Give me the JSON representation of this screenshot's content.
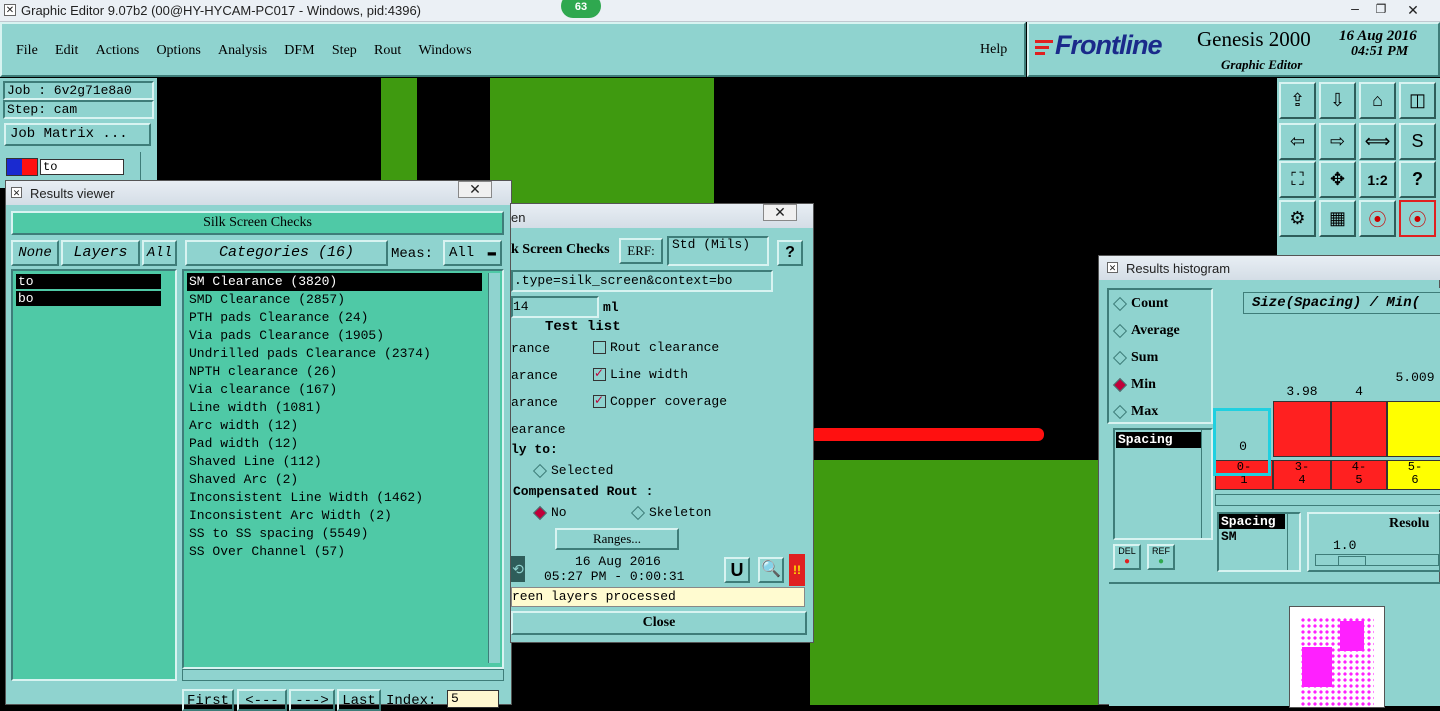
{
  "titlebar": {
    "title": "Graphic Editor 9.07b2 (00@HY-HYCAM-PC017 - Windows, pid:4396)",
    "badge": "63"
  },
  "menu": {
    "items": [
      "File",
      "Edit",
      "Actions",
      "Options",
      "Analysis",
      "DFM",
      "Step",
      "Rout",
      "Windows"
    ],
    "help": "Help"
  },
  "brand": {
    "logo": "Frontline",
    "product": "Genesis 2000",
    "subtitle": "Graphic Editor",
    "date": "16 Aug 2016",
    "time": "04:51 PM"
  },
  "job": {
    "job_line": "Job : 6v2g71e8a0",
    "step_line": "Step: cam",
    "matrix_button": "Job Matrix ...",
    "layer_field": "to"
  },
  "results_viewer": {
    "title": "Results viewer",
    "header": "Silk Screen Checks",
    "none_btn": "None",
    "layers_btn": "Layers",
    "all_btn": "All",
    "layers": [
      "to",
      "bo"
    ],
    "categories_btn": "Categories (16)",
    "meas_label": "Meas:",
    "meas_value": "All",
    "categories": [
      "SM Clearance (3820)",
      "SMD Clearance (2857)",
      "PTH pads Clearance (24)",
      "Via pads Clearance (1905)",
      "Undrilled pads Clearance (2374)",
      "NPTH clearance (26)",
      "Via clearance (167)",
      "Line width (1081)",
      "Arc width (12)",
      "Pad width (12)",
      "Shaved Line (112)",
      "Shaved Arc (2)",
      "Inconsistent Line Width (1462)",
      "Inconsistent Arc Width (2)",
      "SS to SS spacing (5549)",
      "SS Over Channel (57)"
    ],
    "first_btn": "First",
    "prev_btn": "<---",
    "next_btn": "--->",
    "last_btn": "Last",
    "index_label": "Index:",
    "index_value": "5"
  },
  "silk_dialog": {
    "title_fragment": "en",
    "check_label": "k Screen Checks",
    "erf_label": "ERF:",
    "erf_value": "Std (Mils)",
    "help_btn": "?",
    "url_text": ".type=silk_screen&context=bo",
    "value_field": "14",
    "value_unit": "ml",
    "test_list_label": "Test list",
    "left_items": [
      "rance",
      "arance",
      "arance",
      "earance"
    ],
    "right_items": [
      {
        "label": "Rout clearance",
        "checked": false
      },
      {
        "label": "Line width",
        "checked": true
      },
      {
        "label": "Copper coverage",
        "checked": true
      }
    ],
    "apply_label": "ly to:",
    "selected_label": "Selected",
    "comp_rout_label": "Compensated Rout :",
    "no_label": "No",
    "skeleton_label": "Skeleton",
    "ranges_btn": "Ranges...",
    "run_date": "16 Aug 2016",
    "run_time": "05:27 PM - 0:00:31",
    "status_text": "reen layers processed",
    "close_btn": "Close"
  },
  "histogram": {
    "title": "Results histogram",
    "modes": [
      {
        "label": "Count",
        "selected": false
      },
      {
        "label": "Average",
        "selected": false
      },
      {
        "label": "Sum",
        "selected": false
      },
      {
        "label": "Min",
        "selected": true
      },
      {
        "label": "Max",
        "selected": false
      }
    ],
    "chart_title": "Size(Spacing) / Min(",
    "list_item": "Spacing",
    "del_btn": "DEL",
    "ref_btn": "REF",
    "bars": [
      {
        "value": "0",
        "range_top": "0-",
        "range_bottom": "1",
        "color": "#8fd3cf"
      },
      {
        "value": "3.98",
        "range_top": "3-",
        "range_bottom": "4",
        "color": "#ff2020"
      },
      {
        "value": "4",
        "range_top": "4-",
        "range_bottom": "5",
        "color": "#ff2020"
      },
      {
        "value": "5.009",
        "range_top": "5-",
        "range_bottom": "6",
        "color": "#ffff00"
      }
    ],
    "spacing_header": "Spacing",
    "spacing_item": "SM",
    "resolution_label": "Resolu",
    "resolution_value": "1.0"
  }
}
